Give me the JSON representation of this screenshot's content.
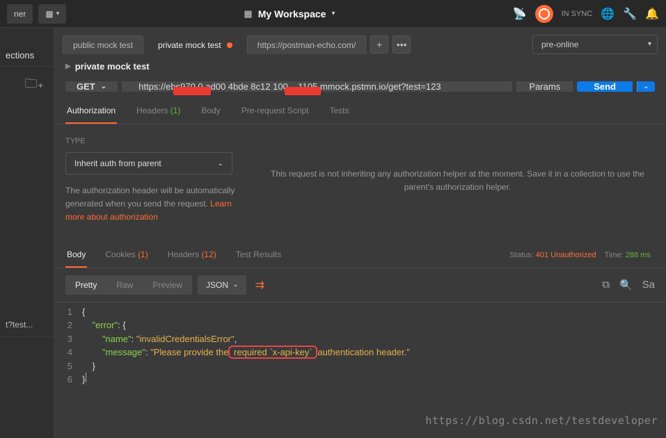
{
  "topbar": {
    "runner": "ner",
    "workspace": "My Workspace",
    "sync": "IN SYNC"
  },
  "sidebar": {
    "collections": "ections",
    "item_test": "t?test..."
  },
  "tabs": {
    "t1": "public mock test",
    "t2": "private mock test",
    "t3": "https://postman-echo.com/"
  },
  "env": {
    "selected": "pre-online"
  },
  "crumb": {
    "title": "private mock test"
  },
  "request": {
    "method": "GET",
    "url": "https://ebs970.0 ad00 4bde 8c12 100    1105 mmock.pstmn.io/get?test=123",
    "params": "Params",
    "send": "Send"
  },
  "reqtabs": {
    "auth": "Authorization",
    "headers": "Headers",
    "headers_cnt": "(1)",
    "body": "Body",
    "prs": "Pre-request Script",
    "tests": "Tests"
  },
  "auth": {
    "type_lbl": "TYPE",
    "select": "Inherit auth from parent",
    "help_1": "The authorization header will be automatically generated when you send the request. ",
    "help_link": "Learn more about authorization",
    "right_msg": "This request is not inheriting any authorization helper at the moment. Save it in a collection to use the parent's authorization helper."
  },
  "resptabs": {
    "body": "Body",
    "cookies": "Cookies",
    "cookies_cnt": "(1)",
    "headers": "Headers",
    "headers_cnt": "(12)",
    "tests": "Test Results"
  },
  "status": {
    "lbl": "Status:",
    "code": "401 Unauthorized",
    "time_lbl": "Time:",
    "time": "288 ms"
  },
  "viewbar": {
    "pretty": "Pretty",
    "raw": "Raw",
    "preview": "Preview",
    "fmt": "JSON",
    "save": "Sa"
  },
  "code": {
    "l2_key": "\"error\"",
    "l3_key": "\"name\"",
    "l3_val": "\"invalidCredentialsError\"",
    "l4_key": "\"message\"",
    "l4_pre": "\"Please provide the",
    "l4_hl": " required `x-api-key` ",
    "l4_post": "authentication header.\""
  },
  "watermark": "https://blog.csdn.net/testdeveloper"
}
